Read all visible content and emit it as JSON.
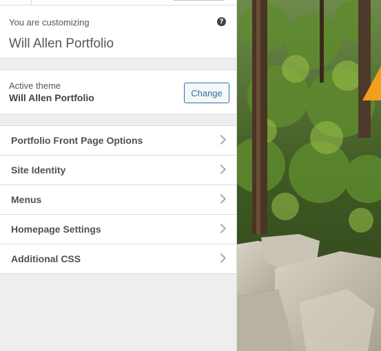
{
  "customizer": {
    "customizing_label": "You are customizing",
    "site_title": "Will Allen Portfolio",
    "help_glyph": "?"
  },
  "theme": {
    "active_label": "Active theme",
    "name": "Will Allen Portfolio",
    "change_label": "Change"
  },
  "sections": [
    {
      "label": "Portfolio Front Page Options"
    },
    {
      "label": "Site Identity"
    },
    {
      "label": "Menus"
    },
    {
      "label": "Homepage Settings"
    },
    {
      "label": "Additional CSS"
    }
  ],
  "icons": {
    "help": "question-mark-circle",
    "chevron": "chevron-right"
  },
  "colors": {
    "accent_blue": "#2271b1",
    "accent_orange": "#f29f1c",
    "text": "#50575e"
  }
}
